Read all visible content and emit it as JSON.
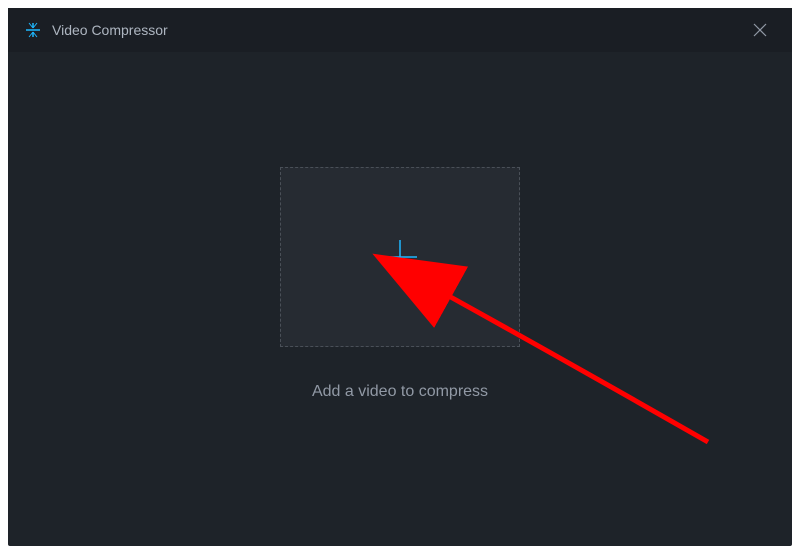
{
  "titlebar": {
    "app_name": "Video Compressor"
  },
  "main": {
    "instruction": "Add a video to compress"
  },
  "colors": {
    "accent": "#1eb8ff",
    "text_muted": "#9199a5",
    "text_title": "#aeb6c1",
    "bg_window": "#1e2329",
    "bg_titlebar": "#1a1e24",
    "bg_dropzone": "#262b32",
    "border_dashed": "#4a5058",
    "annotation": "#ff0000"
  }
}
